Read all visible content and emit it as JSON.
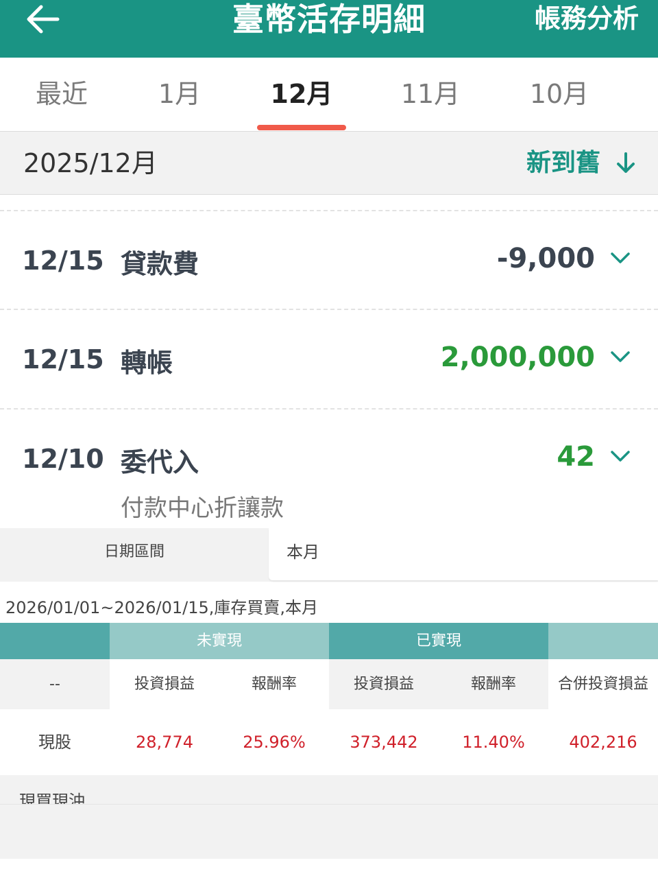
{
  "header": {
    "title": "臺幣活存明細",
    "action_label": "帳務分析"
  },
  "tabs": [
    {
      "label": "最近"
    },
    {
      "label": "1月"
    },
    {
      "label": "12月",
      "active": true
    },
    {
      "label": "11月"
    },
    {
      "label": "10月"
    }
  ],
  "period": {
    "label": "2025/12月",
    "sort_label": "新到舊"
  },
  "transactions": [
    {
      "date": "12/15",
      "description": "貸款費",
      "amount": "-9,000",
      "memo": ""
    },
    {
      "date": "12/15",
      "description": "轉帳",
      "amount": "2,000,000",
      "memo": ""
    },
    {
      "date": "12/10",
      "description": "委代入",
      "amount": "42",
      "memo": "付款中心折讓款"
    }
  ],
  "overlay": {
    "range_label": "日期區間",
    "range_value": "本月",
    "summary": "2026/01/01~2026/01/15,庫存買賣,本月",
    "groups": {
      "unrealized": "未實現",
      "realized": "已實現"
    },
    "columns": [
      "--",
      "投資損益",
      "報酬率",
      "投資損益",
      "報酬率",
      "合併投資損益"
    ],
    "rows": [
      {
        "label": "現股",
        "unrealized_pl": "28,774",
        "unrealized_rate": "25.96%",
        "realized_pl": "373,442",
        "realized_rate": "11.40%",
        "combined_pl": "402,216"
      }
    ],
    "next_section_label": "現買現沖"
  },
  "colors": {
    "brand": "#1a9484",
    "tab_indicator": "#f05a4a",
    "positive_amount": "#2a9a3a",
    "profit_red": "#d0202a",
    "group_dark": "#52a9a8",
    "group_light": "#95c9c7"
  }
}
